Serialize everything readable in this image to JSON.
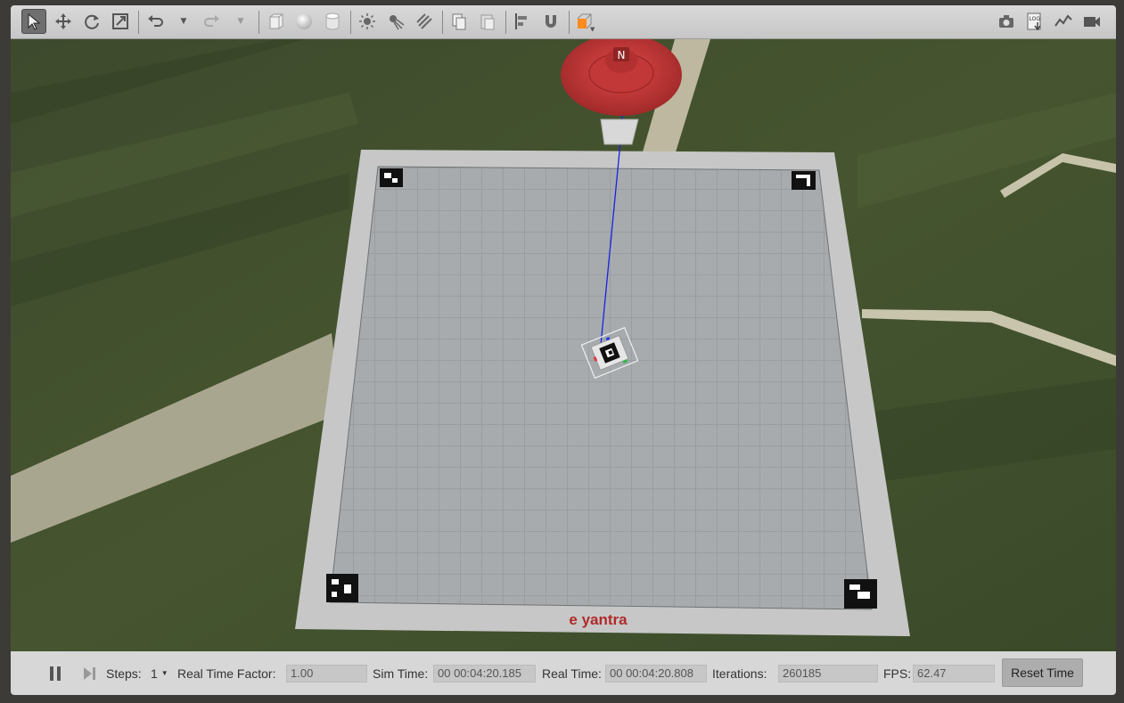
{
  "toolbar": {
    "left_tools": [
      {
        "name": "select-mode-icon",
        "active": true
      },
      {
        "name": "translate-mode-icon"
      },
      {
        "name": "rotate-mode-icon"
      },
      {
        "name": "scale-mode-icon"
      },
      {
        "name": "undo-icon"
      },
      {
        "name": "redo-icon"
      },
      {
        "name": "box-shape-icon"
      },
      {
        "name": "sphere-shape-icon"
      },
      {
        "name": "cylinder-shape-icon"
      },
      {
        "name": "point-light-icon"
      },
      {
        "name": "spot-light-icon"
      },
      {
        "name": "directional-light-icon"
      },
      {
        "name": "copy-icon"
      },
      {
        "name": "paste-icon"
      },
      {
        "name": "align-icon"
      },
      {
        "name": "snap-magnet-icon"
      },
      {
        "name": "view-angle-icon"
      }
    ],
    "right_tools": [
      {
        "name": "screenshot-camera-icon"
      },
      {
        "name": "log-icon",
        "label": "LOG"
      },
      {
        "name": "plot-icon"
      },
      {
        "name": "video-record-icon"
      }
    ]
  },
  "viewport": {
    "arena_logo": "e yantra",
    "drone_marker_label": "N"
  },
  "bottom_bar": {
    "steps_label": "Steps:",
    "steps_value": "1",
    "rtf_label": "Real Time Factor:",
    "rtf_value": "1.00",
    "sim_time_label": "Sim Time:",
    "sim_time_value": "00 00:04:20.185",
    "real_time_label": "Real Time:",
    "real_time_value": "00 00:04:20.808",
    "iterations_label": "Iterations:",
    "iterations_value": "260185",
    "fps_label": "FPS:",
    "fps_value": "62.47",
    "reset_label": "Reset Time"
  },
  "colors": {
    "toolbar_bg": "#d0d0d0",
    "grass": "#3e5030",
    "arena_border": "#c8c8c8",
    "arena_grid": "#a3a8ab",
    "drone_red": "#c23a3a",
    "tether_blue": "#1a22e0",
    "logo_red": "#b02a2a"
  }
}
